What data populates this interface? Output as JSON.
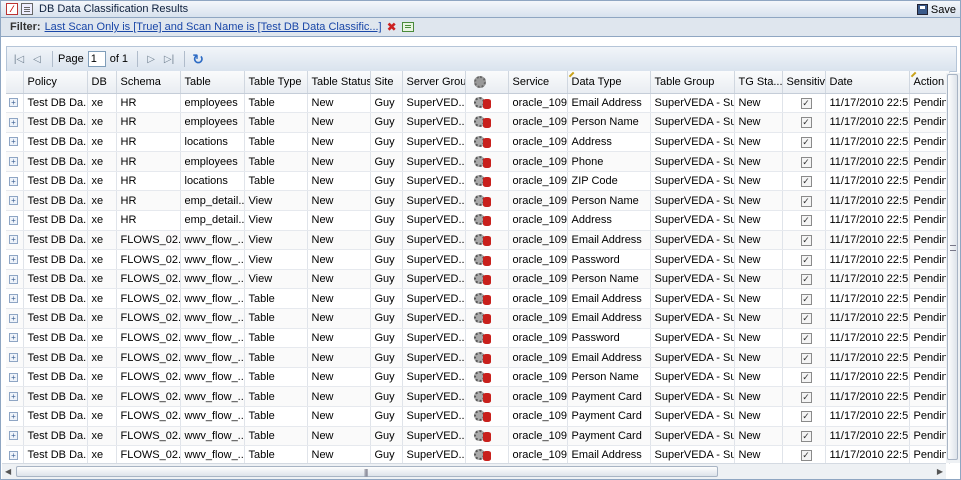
{
  "window": {
    "title": "DB Data Classification Results",
    "save_label": "Save"
  },
  "filter": {
    "label": "Filter:",
    "text": "Last Scan Only is [True] and Scan Name is [Test DB Data Classific...]"
  },
  "pager": {
    "page_label": "Page",
    "page_value": "1",
    "of_label": "of 1"
  },
  "columns": [
    "Policy",
    "DB",
    "Schema",
    "Table",
    "Table Type",
    "Table Status",
    "Site",
    "Server Group",
    "",
    "Service",
    "Data Type",
    "Table Group",
    "TG Sta...",
    "Sensitive",
    "Date",
    "Action"
  ],
  "rows": [
    {
      "policy": "Test DB Da...",
      "db": "xe",
      "schema": "HR",
      "table": "employees",
      "type": "Table",
      "status": "New",
      "site": "Guy",
      "server_group": "SuperVED...",
      "service": "oracle_109",
      "data_type": "Email Address",
      "table_group": "SuperVEDA - Su...",
      "tg_status": "New",
      "date": "11/17/2010 22:51",
      "action": "Pending"
    },
    {
      "policy": "Test DB Da...",
      "db": "xe",
      "schema": "HR",
      "table": "employees",
      "type": "Table",
      "status": "New",
      "site": "Guy",
      "server_group": "SuperVED...",
      "service": "oracle_109",
      "data_type": "Person Name",
      "table_group": "SuperVEDA - Su...",
      "tg_status": "New",
      "date": "11/17/2010 22:51",
      "action": "Pending"
    },
    {
      "policy": "Test DB Da...",
      "db": "xe",
      "schema": "HR",
      "table": "locations",
      "type": "Table",
      "status": "New",
      "site": "Guy",
      "server_group": "SuperVED...",
      "service": "oracle_109",
      "data_type": "Address",
      "table_group": "SuperVEDA - Su...",
      "tg_status": "New",
      "date": "11/17/2010 22:51",
      "action": "Pending"
    },
    {
      "policy": "Test DB Da...",
      "db": "xe",
      "schema": "HR",
      "table": "employees",
      "type": "Table",
      "status": "New",
      "site": "Guy",
      "server_group": "SuperVED...",
      "service": "oracle_109",
      "data_type": "Phone",
      "table_group": "SuperVEDA - Su...",
      "tg_status": "New",
      "date": "11/17/2010 22:51",
      "action": "Pending"
    },
    {
      "policy": "Test DB Da...",
      "db": "xe",
      "schema": "HR",
      "table": "locations",
      "type": "Table",
      "status": "New",
      "site": "Guy",
      "server_group": "SuperVED...",
      "service": "oracle_109",
      "data_type": "ZIP Code",
      "table_group": "SuperVEDA - Su...",
      "tg_status": "New",
      "date": "11/17/2010 22:51",
      "action": "Pending"
    },
    {
      "policy": "Test DB Da...",
      "db": "xe",
      "schema": "HR",
      "table": "emp_detail...",
      "type": "View",
      "status": "New",
      "site": "Guy",
      "server_group": "SuperVED...",
      "service": "oracle_109",
      "data_type": "Person Name",
      "table_group": "SuperVEDA - Su...",
      "tg_status": "New",
      "date": "11/17/2010 22:51",
      "action": "Pending"
    },
    {
      "policy": "Test DB Da...",
      "db": "xe",
      "schema": "HR",
      "table": "emp_detail...",
      "type": "View",
      "status": "New",
      "site": "Guy",
      "server_group": "SuperVED...",
      "service": "oracle_109",
      "data_type": "Address",
      "table_group": "SuperVEDA - Su...",
      "tg_status": "New",
      "date": "11/17/2010 22:51",
      "action": "Pending"
    },
    {
      "policy": "Test DB Da...",
      "db": "xe",
      "schema": "FLOWS_02...",
      "table": "wwv_flow_...",
      "type": "View",
      "status": "New",
      "site": "Guy",
      "server_group": "SuperVED...",
      "service": "oracle_109",
      "data_type": "Email Address",
      "table_group": "SuperVEDA - Su...",
      "tg_status": "New",
      "date": "11/17/2010 22:51",
      "action": "Pending"
    },
    {
      "policy": "Test DB Da...",
      "db": "xe",
      "schema": "FLOWS_02...",
      "table": "wwv_flow_...",
      "type": "View",
      "status": "New",
      "site": "Guy",
      "server_group": "SuperVED...",
      "service": "oracle_109",
      "data_type": "Password",
      "table_group": "SuperVEDA - Su...",
      "tg_status": "New",
      "date": "11/17/2010 22:51",
      "action": "Pending"
    },
    {
      "policy": "Test DB Da...",
      "db": "xe",
      "schema": "FLOWS_02...",
      "table": "wwv_flow_...",
      "type": "View",
      "status": "New",
      "site": "Guy",
      "server_group": "SuperVED...",
      "service": "oracle_109",
      "data_type": "Person Name",
      "table_group": "SuperVEDA - Su...",
      "tg_status": "New",
      "date": "11/17/2010 22:51",
      "action": "Pending"
    },
    {
      "policy": "Test DB Da...",
      "db": "xe",
      "schema": "FLOWS_02...",
      "table": "wwv_flow_...",
      "type": "Table",
      "status": "New",
      "site": "Guy",
      "server_group": "SuperVED...",
      "service": "oracle_109",
      "data_type": "Email Address",
      "table_group": "SuperVEDA - Su...",
      "tg_status": "New",
      "date": "11/17/2010 22:51",
      "action": "Pending"
    },
    {
      "policy": "Test DB Da...",
      "db": "xe",
      "schema": "FLOWS_02...",
      "table": "wwv_flow_...",
      "type": "Table",
      "status": "New",
      "site": "Guy",
      "server_group": "SuperVED...",
      "service": "oracle_109",
      "data_type": "Email Address",
      "table_group": "SuperVEDA - Su...",
      "tg_status": "New",
      "date": "11/17/2010 22:51",
      "action": "Pending"
    },
    {
      "policy": "Test DB Da...",
      "db": "xe",
      "schema": "FLOWS_02...",
      "table": "wwv_flow_...",
      "type": "Table",
      "status": "New",
      "site": "Guy",
      "server_group": "SuperVED...",
      "service": "oracle_109",
      "data_type": "Password",
      "table_group": "SuperVEDA - Su...",
      "tg_status": "New",
      "date": "11/17/2010 22:51",
      "action": "Pending"
    },
    {
      "policy": "Test DB Da...",
      "db": "xe",
      "schema": "FLOWS_02...",
      "table": "wwv_flow_...",
      "type": "Table",
      "status": "New",
      "site": "Guy",
      "server_group": "SuperVED...",
      "service": "oracle_109",
      "data_type": "Email Address",
      "table_group": "SuperVEDA - Su...",
      "tg_status": "New",
      "date": "11/17/2010 22:51",
      "action": "Pending"
    },
    {
      "policy": "Test DB Da...",
      "db": "xe",
      "schema": "FLOWS_02...",
      "table": "wwv_flow_...",
      "type": "Table",
      "status": "New",
      "site": "Guy",
      "server_group": "SuperVED...",
      "service": "oracle_109",
      "data_type": "Person Name",
      "table_group": "SuperVEDA - Su...",
      "tg_status": "New",
      "date": "11/17/2010 22:51",
      "action": "Pending"
    },
    {
      "policy": "Test DB Da...",
      "db": "xe",
      "schema": "FLOWS_02...",
      "table": "wwv_flow_...",
      "type": "Table",
      "status": "New",
      "site": "Guy",
      "server_group": "SuperVED...",
      "service": "oracle_109",
      "data_type": "Payment Card",
      "table_group": "SuperVEDA - Su...",
      "tg_status": "New",
      "date": "11/17/2010 22:51",
      "action": "Pending"
    },
    {
      "policy": "Test DB Da...",
      "db": "xe",
      "schema": "FLOWS_02...",
      "table": "wwv_flow_...",
      "type": "Table",
      "status": "New",
      "site": "Guy",
      "server_group": "SuperVED...",
      "service": "oracle_109",
      "data_type": "Payment Card",
      "table_group": "SuperVEDA - Su...",
      "tg_status": "New",
      "date": "11/17/2010 22:51",
      "action": "Pending"
    },
    {
      "policy": "Test DB Da...",
      "db": "xe",
      "schema": "FLOWS_02...",
      "table": "wwv_flow_...",
      "type": "Table",
      "status": "New",
      "site": "Guy",
      "server_group": "SuperVED...",
      "service": "oracle_109",
      "data_type": "Payment Card",
      "table_group": "SuperVEDA - Su...",
      "tg_status": "New",
      "date": "11/17/2010 22:51",
      "action": "Pending"
    },
    {
      "policy": "Test DB Da...",
      "db": "xe",
      "schema": "FLOWS_02...",
      "table": "wwv_flow_...",
      "type": "Table",
      "status": "New",
      "site": "Guy",
      "server_group": "SuperVED...",
      "service": "oracle_109",
      "data_type": "Email Address",
      "table_group": "SuperVEDA - Su...",
      "tg_status": "New",
      "date": "11/17/2010 22:51",
      "action": "Pending"
    }
  ],
  "icons": {
    "pdf": "pdf-icon",
    "doc": "document-icon",
    "save": "floppy-disk-icon",
    "clear_filter": "red-x-icon",
    "edit_filter": "filter-edit-icon",
    "server_group": "gear-database-icon",
    "refresh": "refresh-icon"
  },
  "colors": {
    "link": "#1a47a8",
    "header_bg": "#dfe6ee",
    "db_icon": "#c8201c"
  }
}
